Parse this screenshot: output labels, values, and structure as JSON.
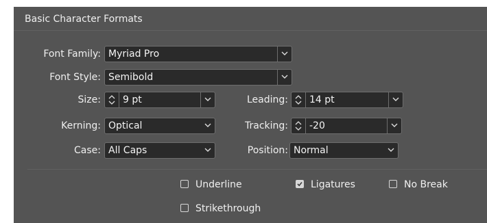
{
  "panel": {
    "title": "Basic Character Formats"
  },
  "font_family": {
    "label": "Font Family:",
    "value": "Myriad Pro"
  },
  "font_style": {
    "label": "Font Style:",
    "value": "Semibold"
  },
  "size": {
    "label": "Size:",
    "value": "9 pt"
  },
  "leading": {
    "label": "Leading:",
    "value": "14 pt"
  },
  "kerning": {
    "label": "Kerning:",
    "value": "Optical"
  },
  "tracking": {
    "label": "Tracking:",
    "value": "-20"
  },
  "case": {
    "label": "Case:",
    "value": "All Caps"
  },
  "position": {
    "label": "Position:",
    "value": "Normal"
  },
  "options": {
    "underline": {
      "label": "Underline",
      "checked": false
    },
    "ligatures": {
      "label": "Ligatures",
      "checked": true
    },
    "no_break": {
      "label": "No Break",
      "checked": false
    },
    "strikethrough": {
      "label": "Strikethrough",
      "checked": false
    }
  },
  "colors": {
    "panel_bg": "#545454",
    "field_bg": "#2a2a2a",
    "border": "#6e6e6e",
    "text": "#f0f0f0"
  },
  "icons": {
    "dropdown": "chevron-down-icon",
    "stepper": "stepper-arrows-icon",
    "check": "checkmark-icon"
  }
}
